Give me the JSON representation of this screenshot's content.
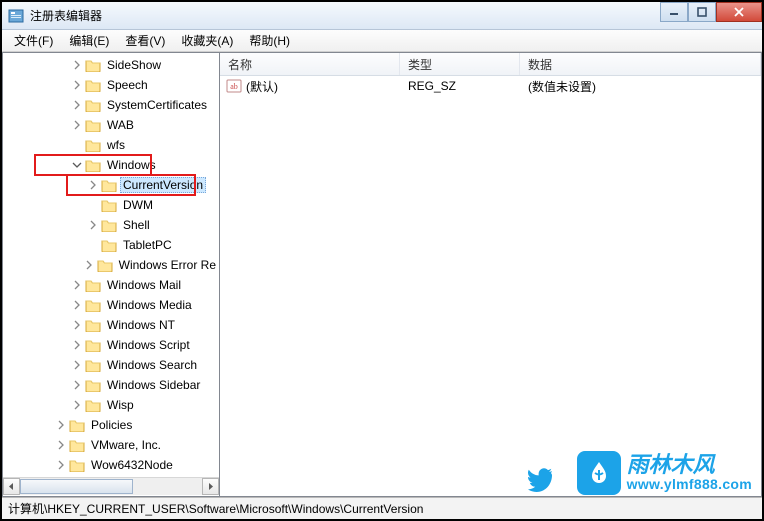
{
  "window": {
    "title": "注册表编辑器"
  },
  "menus": {
    "file": "文件(F)",
    "edit": "编辑(E)",
    "view": "查看(V)",
    "favorites": "收藏夹(A)",
    "help": "帮助(H)"
  },
  "tree": {
    "items": [
      {
        "label": "SideShow",
        "depth": 3,
        "exp": "closed"
      },
      {
        "label": "Speech",
        "depth": 3,
        "exp": "closed"
      },
      {
        "label": "SystemCertificates",
        "depth": 3,
        "exp": "closed"
      },
      {
        "label": "WAB",
        "depth": 3,
        "exp": "closed"
      },
      {
        "label": "wfs",
        "depth": 3,
        "exp": "none"
      },
      {
        "label": "Windows",
        "depth": 3,
        "exp": "open",
        "highlight": true
      },
      {
        "label": "CurrentVersion",
        "depth": 4,
        "exp": "closed",
        "selected": true,
        "highlight": true
      },
      {
        "label": "DWM",
        "depth": 4,
        "exp": "none"
      },
      {
        "label": "Shell",
        "depth": 4,
        "exp": "closed"
      },
      {
        "label": "TabletPC",
        "depth": 4,
        "exp": "none"
      },
      {
        "label": "Windows Error Re",
        "depth": 4,
        "exp": "closed"
      },
      {
        "label": "Windows Mail",
        "depth": 3,
        "exp": "closed"
      },
      {
        "label": "Windows Media",
        "depth": 3,
        "exp": "closed"
      },
      {
        "label": "Windows NT",
        "depth": 3,
        "exp": "closed"
      },
      {
        "label": "Windows Script",
        "depth": 3,
        "exp": "closed"
      },
      {
        "label": "Windows Search",
        "depth": 3,
        "exp": "closed"
      },
      {
        "label": "Windows Sidebar",
        "depth": 3,
        "exp": "closed"
      },
      {
        "label": "Wisp",
        "depth": 3,
        "exp": "closed"
      },
      {
        "label": "Policies",
        "depth": 2,
        "exp": "closed"
      },
      {
        "label": "VMware, Inc.",
        "depth": 2,
        "exp": "closed"
      },
      {
        "label": "Wow6432Node",
        "depth": 2,
        "exp": "closed"
      }
    ]
  },
  "list": {
    "headers": {
      "name": "名称",
      "type": "类型",
      "data": "数据"
    },
    "rows": [
      {
        "name": "(默认)",
        "type": "REG_SZ",
        "data": "(数值未设置)",
        "icon": "ab"
      }
    ]
  },
  "status": {
    "path": "计算机\\HKEY_CURRENT_USER\\Software\\Microsoft\\Windows\\CurrentVersion"
  },
  "watermark": {
    "brand": "雨林木风",
    "url": "www.ylmf888.com"
  },
  "colors": {
    "highlight": "#e21b1b",
    "selection": "#cce8ff",
    "brand": "#1ca3e8"
  }
}
